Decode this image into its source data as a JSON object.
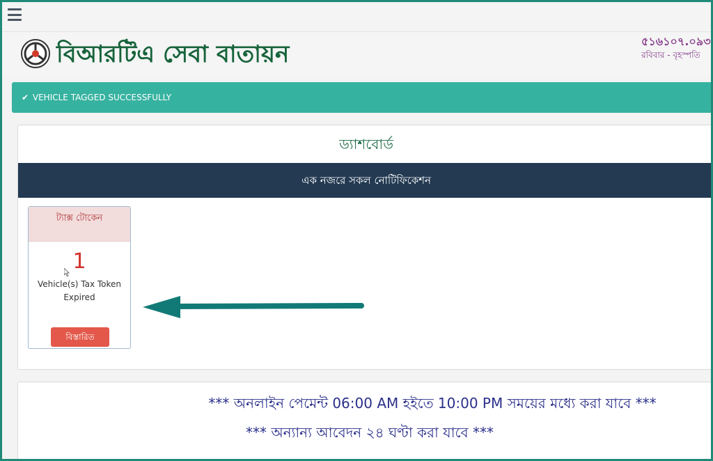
{
  "header": {
    "title": "বিআরটিএ সেবা বাতায়ন",
    "right_line1": "৫১৬১০৭.০৯৩",
    "right_line2": "রবিবার - বৃহস্পতি"
  },
  "alert": {
    "text": "VEHICLE TAGGED SUCCESSFULLY",
    "color": "#36b2a0"
  },
  "dashboard": {
    "title": "ড্যাশবোর্ড",
    "subheading": "এক নজরে সকল নোটিফিকেশন",
    "card": {
      "header": "ট্যাক্স টোকেন",
      "count": "1",
      "description_line1": "Vehicle(s) Tax Token",
      "description_line2": "Expired",
      "button_label": "বিস্তারিত"
    }
  },
  "notices": {
    "line1": "*** অনলাইন পেমেন্ট 06:00 AM হইতে 10:00 PM সময়ের মধ্যে করা যাবে ***",
    "line2": "*** অন্যান্য আবেদন ২৪ ঘণ্টা করা যাবে ***"
  },
  "icons": {
    "menu": "hamburger-menu-icon",
    "logo": "brta-logo",
    "check": "check-icon",
    "arrow": "left-arrow-annotation"
  },
  "colors": {
    "brand_green": "#17633b",
    "navy": "#233a52",
    "danger": "#e3584a",
    "frame": "#1f8a78"
  }
}
